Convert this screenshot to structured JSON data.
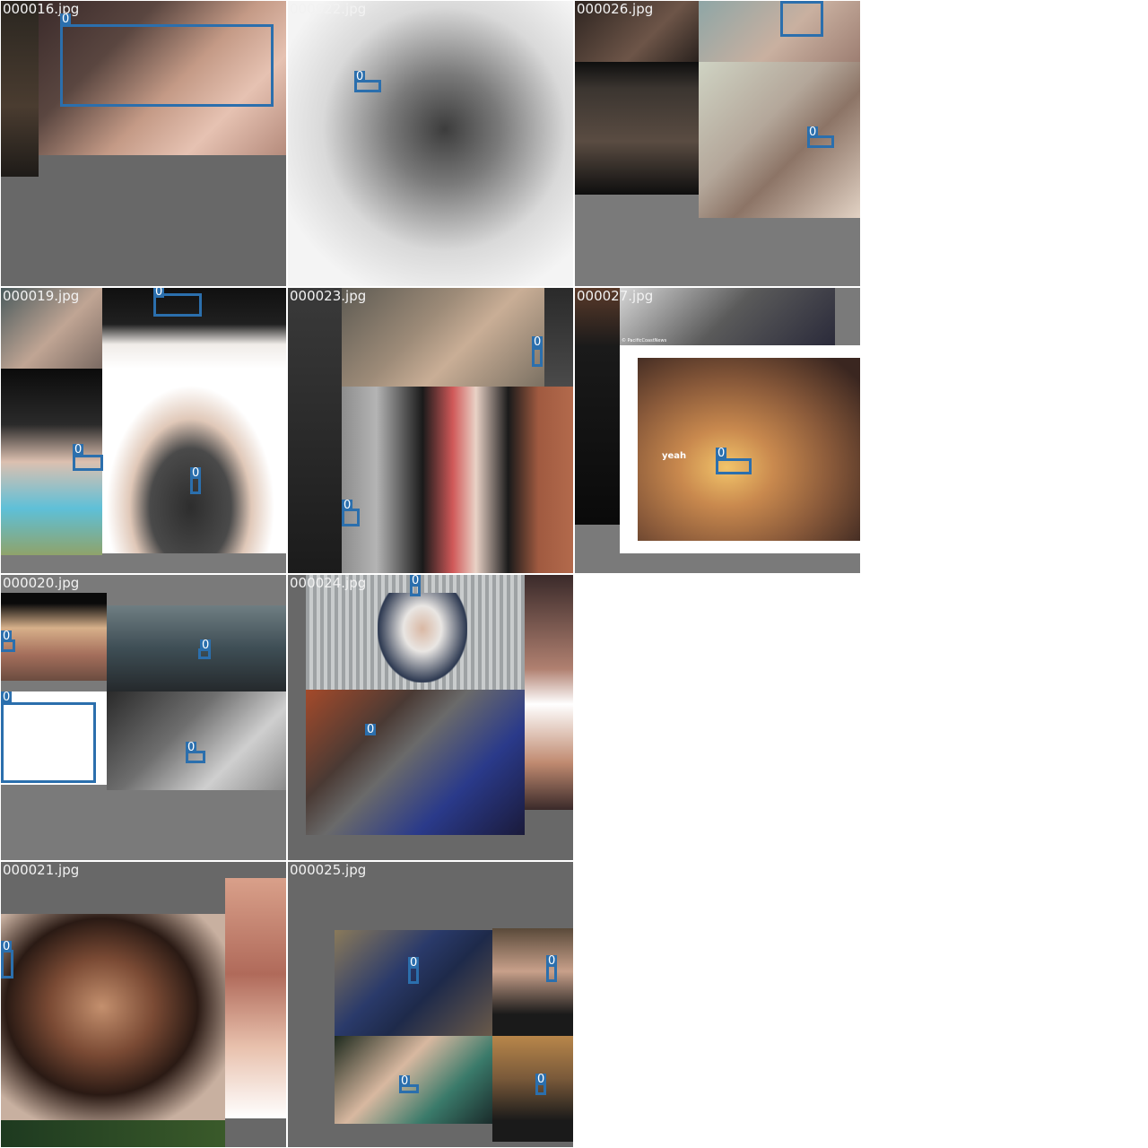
{
  "grid": {
    "colors": {
      "box": "#2b6fad",
      "filename_text": "#f2f2f2",
      "padding": "#7a7a7a"
    },
    "tiles": [
      {
        "filename": "000016.jpg",
        "labels": [
          "0"
        ]
      },
      {
        "filename": "000022.jpg",
        "labels": [
          "0"
        ]
      },
      {
        "filename": "000026.jpg",
        "labels": [
          "0"
        ]
      },
      {
        "filename": "000019.jpg",
        "labels": [
          "0",
          "0",
          "0"
        ]
      },
      {
        "filename": "000023.jpg",
        "labels": [
          "0",
          "0"
        ]
      },
      {
        "filename": "000027.jpg",
        "labels": [
          "0"
        ],
        "caption_text": "yeah",
        "credit_text": "© PacificCoastNews"
      },
      {
        "filename": "000020.jpg",
        "labels": [
          "0",
          "0",
          "0",
          "0"
        ]
      },
      {
        "filename": "000024.jpg",
        "labels": [
          "0",
          "0"
        ]
      },
      {
        "filename": "000021.jpg",
        "labels": [
          "0"
        ]
      },
      {
        "filename": "000025.jpg",
        "labels": [
          "0",
          "0",
          "0",
          "0"
        ]
      }
    ]
  }
}
